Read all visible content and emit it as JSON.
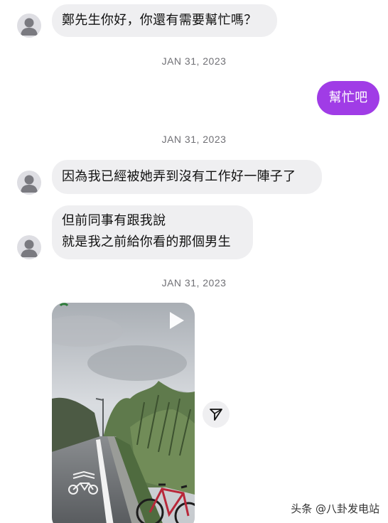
{
  "messages": {
    "msg1": "鄭先生你好，你還有需要幫忙嗎？",
    "msg2": "幫忙吧",
    "msg3": "因為我已經被她弄到沒有工作好一陣子了",
    "msg4_line1": "但前同事有跟我說",
    "msg4_line2": "就是我之前給你看的那個男生"
  },
  "dates": {
    "d1": "JAN 31, 2023",
    "d2": "JAN 31, 2023",
    "d3": "JAN 31, 2023"
  },
  "icons": {
    "avatar": "default-avatar-icon",
    "play": "play-icon",
    "share": "send-icon",
    "bike_lane": "bicycle-lane-marking"
  },
  "colors": {
    "outgoing_bubble": "#a03ce6",
    "incoming_bubble": "#efeff1",
    "date_text": "#707075"
  },
  "watermark": "头条 @八卦发电站"
}
